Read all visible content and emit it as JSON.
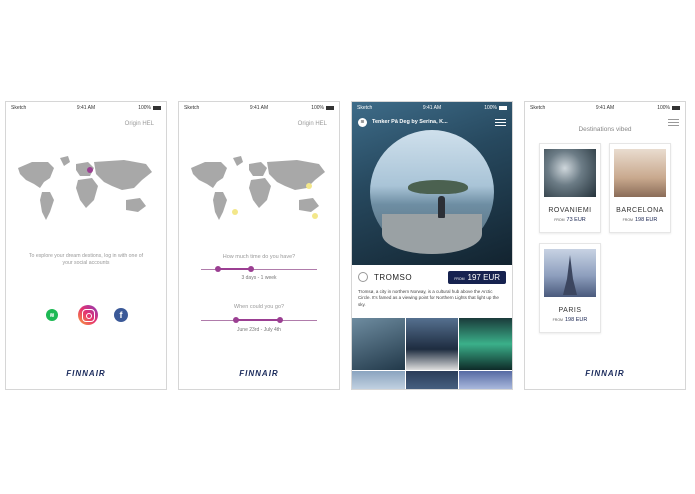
{
  "status": {
    "carrier": "Sketch",
    "time": "9:41 AM",
    "battery": "100%"
  },
  "brand": {
    "logo": "FINNAIR",
    "navy": "#16224f",
    "accent": "#9b3f92"
  },
  "screen1": {
    "origin": "Origin HEL",
    "hint": "To explore your dream destions, log in with one of your social accounts",
    "socials": [
      "spotify-icon",
      "instagram-icon",
      "facebook-icon"
    ]
  },
  "screen2": {
    "origin": "Origin HEL",
    "duration_question": "How much time do you have?",
    "duration_value": "3 days - 1 week",
    "date_question": "When could you go?",
    "date_value": "June 23rd - July 4th"
  },
  "screen3": {
    "playlist": "Tenker På Deg by Serina, K...",
    "destination": "TROMSO",
    "price_from": "FROM",
    "price": "197 EUR",
    "description": "Tromsø, a city in northern Norway, is a cultural hub above the Arctic Circle. It's famed as a viewing point for Northern Lights that light up the sky."
  },
  "screen4": {
    "title": "Destinations vibed",
    "cards": [
      {
        "name": "ROVANIEMI",
        "from": "FROM",
        "price": "73 EUR"
      },
      {
        "name": "BARCELONA",
        "from": "FROM",
        "price": "198 EUR"
      },
      {
        "name": "PARIS",
        "from": "FROM",
        "price": "198 EUR"
      }
    ]
  }
}
